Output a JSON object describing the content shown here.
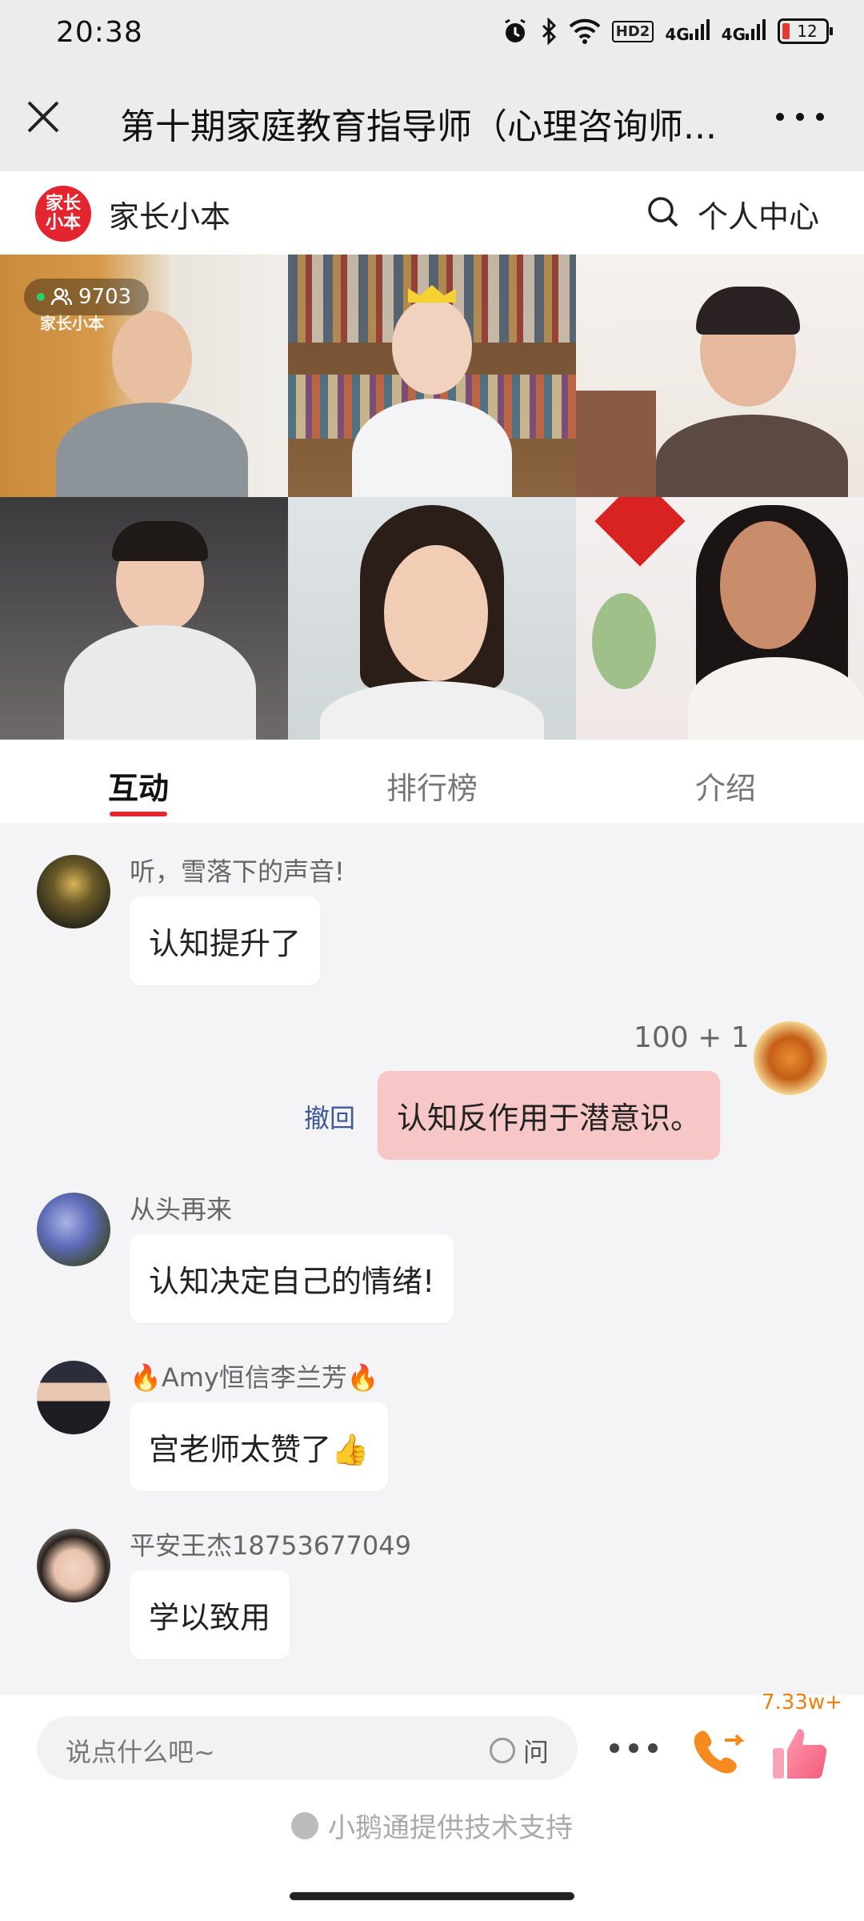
{
  "status": {
    "time": "20:38",
    "hd_label": "HD2",
    "signal1": "4G",
    "signal2": "4G",
    "battery": "12"
  },
  "titlebar": {
    "title": "第十期家庭教育指导师（心理咨询师..."
  },
  "header": {
    "logo_text": "家长小本",
    "brand": "家长小本",
    "user_center": "个人中心"
  },
  "video": {
    "viewer_count": "9703",
    "watermark": "家长小本"
  },
  "tabs": [
    {
      "label": "互动",
      "active": true
    },
    {
      "label": "排行榜",
      "active": false
    },
    {
      "label": "介绍",
      "active": false
    }
  ],
  "chat": {
    "messages": [
      {
        "user": "听，雪落下的声音!",
        "text": "认知提升了"
      },
      {
        "user": "100 + 1",
        "text": "认知反作用于潜意识。",
        "recall": "撤回"
      },
      {
        "user": "从头再来",
        "text": "认知决定自己的情绪!"
      },
      {
        "user": "Amy恒信李兰芳",
        "text": "宫老师太赞了👍"
      },
      {
        "user": "平安王杰18753677049",
        "text": "学以致用"
      }
    ]
  },
  "inputbar": {
    "placeholder": "说点什么吧~",
    "ask_label": "问",
    "like_count": "7.33w+",
    "powered_by": "小鹅通提供技术支持"
  },
  "colors": {
    "accent": "#e2252e",
    "my_bubble": "#f7c6c6",
    "recall_link": "#3b5998",
    "like_count": "#f07f12"
  }
}
